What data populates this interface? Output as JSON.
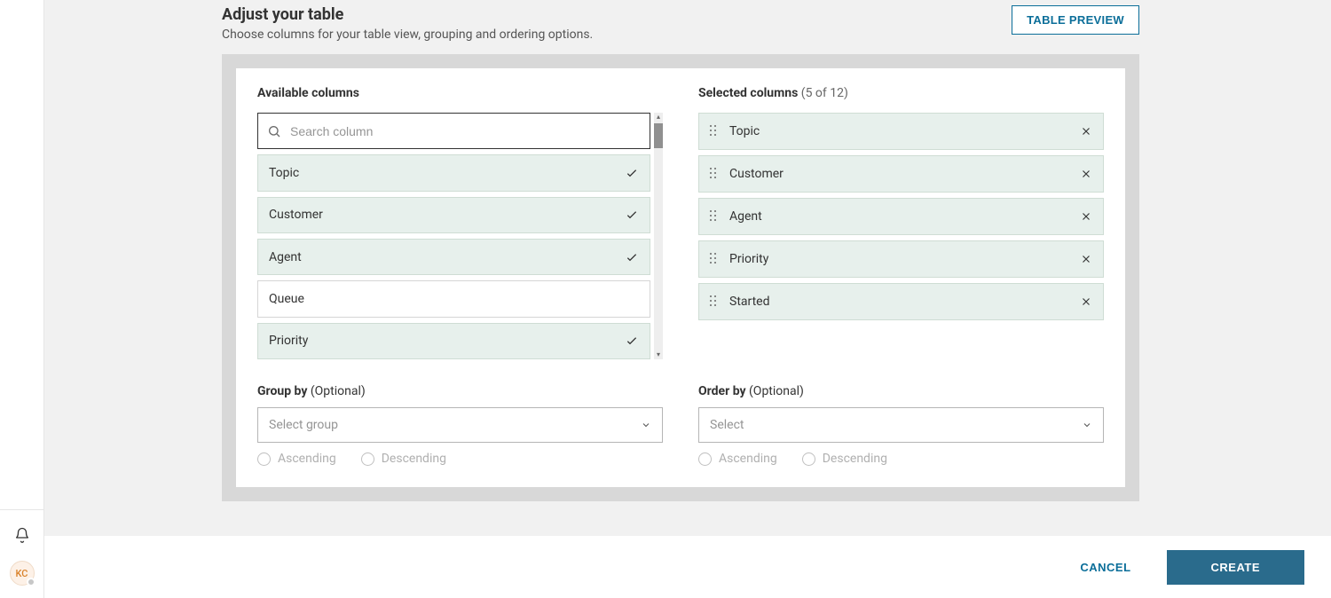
{
  "header": {
    "title": "Adjust your table",
    "subtitle": "Choose columns for your table view, grouping and ordering options.",
    "preview_button": "TABLE PREVIEW"
  },
  "available": {
    "title": "Available columns",
    "search_placeholder": "Search column",
    "items": [
      {
        "label": "Topic",
        "selected": true
      },
      {
        "label": "Customer",
        "selected": true
      },
      {
        "label": "Agent",
        "selected": true
      },
      {
        "label": "Queue",
        "selected": false
      },
      {
        "label": "Priority",
        "selected": true
      }
    ]
  },
  "selected": {
    "title": "Selected columns",
    "count": "(5 of 12)",
    "items": [
      {
        "label": "Topic"
      },
      {
        "label": "Customer"
      },
      {
        "label": "Agent"
      },
      {
        "label": "Priority"
      },
      {
        "label": "Started"
      }
    ]
  },
  "group_by": {
    "label": "Group by",
    "optional": " (Optional)",
    "placeholder": "Select group",
    "asc": "Ascending",
    "desc": "Descending"
  },
  "order_by": {
    "label": "Order by",
    "optional": " (Optional)",
    "placeholder": "Select",
    "asc": "Ascending",
    "desc": "Descending"
  },
  "footer": {
    "cancel": "CANCEL",
    "create": "CREATE"
  },
  "user": {
    "initials": "KC"
  }
}
